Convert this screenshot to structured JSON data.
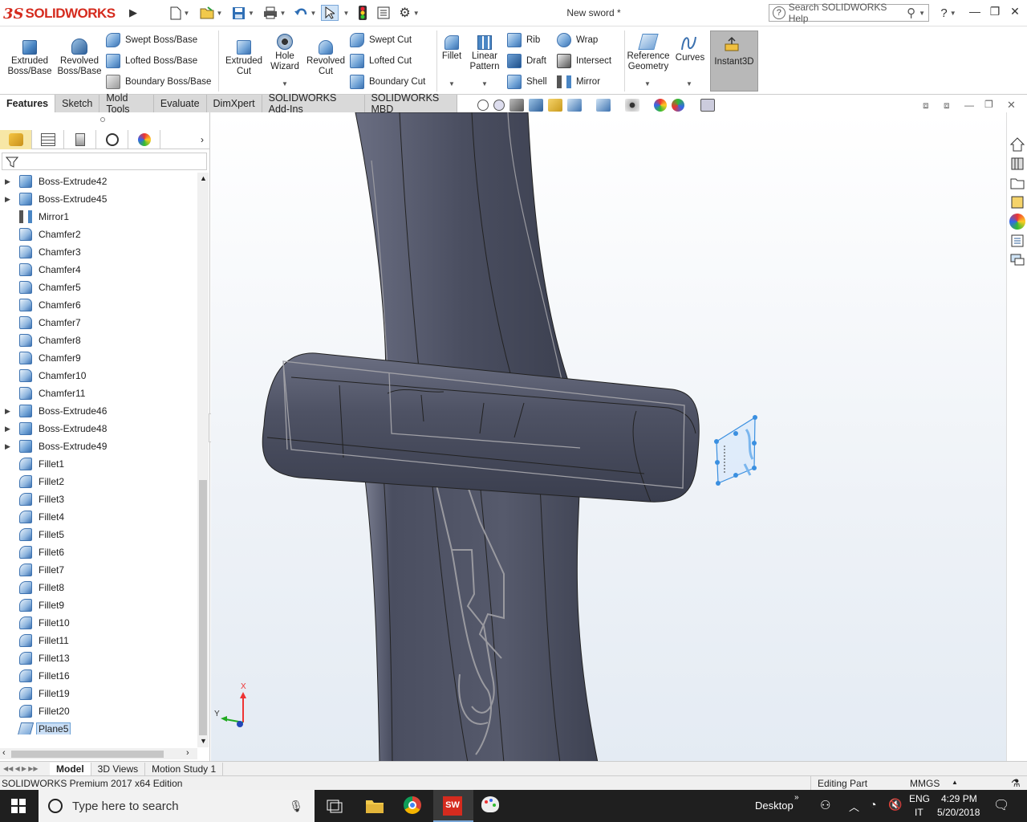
{
  "app": {
    "logo_ds": "3S",
    "logo_text": "SOLIDWORKS",
    "document_title": "New sword *",
    "search_placeholder": "Search SOLIDWORKS Help",
    "help_label": "?"
  },
  "ribbon": {
    "extruded_boss": [
      "Extruded",
      "Boss/Base"
    ],
    "revolved_boss": [
      "Revolved",
      "Boss/Base"
    ],
    "swept_boss": "Swept Boss/Base",
    "lofted_boss": "Lofted Boss/Base",
    "boundary_boss": "Boundary Boss/Base",
    "extruded_cut": [
      "Extruded",
      "Cut"
    ],
    "hole_wizard": [
      "Hole",
      "Wizard"
    ],
    "revolved_cut": [
      "Revolved",
      "Cut"
    ],
    "swept_cut": "Swept Cut",
    "lofted_cut": "Lofted Cut",
    "boundary_cut": "Boundary Cut",
    "fillet": "Fillet",
    "linear_pattern": [
      "Linear",
      "Pattern"
    ],
    "rib": "Rib",
    "draft": "Draft",
    "shell": "Shell",
    "wrap": "Wrap",
    "intersect": "Intersect",
    "mirror": "Mirror",
    "reference_geometry": [
      "Reference",
      "Geometry"
    ],
    "curves": "Curves",
    "instant3d": "Instant3D"
  },
  "tabs": [
    "Features",
    "Sketch",
    "Mold Tools",
    "Evaluate",
    "DimXpert",
    "SOLIDWORKS Add-Ins",
    "SOLIDWORKS MBD"
  ],
  "tree": [
    {
      "label": "Boss-Extrude42",
      "type": "extrude",
      "expandable": true
    },
    {
      "label": "Boss-Extrude45",
      "type": "extrude",
      "expandable": true
    },
    {
      "label": "Mirror1",
      "type": "mirror",
      "expandable": false
    },
    {
      "label": "Chamfer2",
      "type": "chamfer",
      "expandable": false
    },
    {
      "label": "Chamfer3",
      "type": "chamfer",
      "expandable": false
    },
    {
      "label": "Chamfer4",
      "type": "chamfer",
      "expandable": false
    },
    {
      "label": "Chamfer5",
      "type": "chamfer",
      "expandable": false
    },
    {
      "label": "Chamfer6",
      "type": "chamfer",
      "expandable": false
    },
    {
      "label": "Chamfer7",
      "type": "chamfer",
      "expandable": false
    },
    {
      "label": "Chamfer8",
      "type": "chamfer",
      "expandable": false
    },
    {
      "label": "Chamfer9",
      "type": "chamfer",
      "expandable": false
    },
    {
      "label": "Chamfer10",
      "type": "chamfer",
      "expandable": false
    },
    {
      "label": "Chamfer11",
      "type": "chamfer",
      "expandable": false
    },
    {
      "label": "Boss-Extrude46",
      "type": "extrude",
      "expandable": true
    },
    {
      "label": "Boss-Extrude48",
      "type": "extrude",
      "expandable": true
    },
    {
      "label": "Boss-Extrude49",
      "type": "extrude",
      "expandable": true
    },
    {
      "label": "Fillet1",
      "type": "fillet",
      "expandable": false
    },
    {
      "label": "Fillet2",
      "type": "fillet",
      "expandable": false
    },
    {
      "label": "Fillet3",
      "type": "fillet",
      "expandable": false
    },
    {
      "label": "Fillet4",
      "type": "fillet",
      "expandable": false
    },
    {
      "label": "Fillet5",
      "type": "fillet",
      "expandable": false
    },
    {
      "label": "Fillet6",
      "type": "fillet",
      "expandable": false
    },
    {
      "label": "Fillet7",
      "type": "fillet",
      "expandable": false
    },
    {
      "label": "Fillet8",
      "type": "fillet",
      "expandable": false
    },
    {
      "label": "Fillet9",
      "type": "fillet",
      "expandable": false
    },
    {
      "label": "Fillet10",
      "type": "fillet",
      "expandable": false
    },
    {
      "label": "Fillet11",
      "type": "fillet",
      "expandable": false
    },
    {
      "label": "Fillet13",
      "type": "fillet",
      "expandable": false
    },
    {
      "label": "Fillet16",
      "type": "fillet",
      "expandable": false
    },
    {
      "label": "Fillet19",
      "type": "fillet",
      "expandable": false
    },
    {
      "label": "Fillet20",
      "type": "fillet",
      "expandable": false
    },
    {
      "label": "Plane5",
      "type": "plane",
      "expandable": false,
      "selected": true
    }
  ],
  "triad": {
    "x": "X",
    "y": "Y"
  },
  "bottom_tabs": [
    "Model",
    "3D Views",
    "Motion Study 1"
  ],
  "status": {
    "edition": "SOLIDWORKS Premium 2017 x64 Edition",
    "mode": "Editing Part",
    "units": "MMGS"
  },
  "taskbar": {
    "search_placeholder": "Type here to search",
    "desktop": "Desktop",
    "lang_top": "ENG",
    "lang_bottom": "IT",
    "time": "4:29 PM",
    "date": "5/20/2018"
  },
  "colors": {
    "brand_red": "#d52b1e",
    "model_body": "#55596b",
    "selection_blue": "#3a8fe0",
    "tree_icon_blue": "#3d72b0"
  }
}
